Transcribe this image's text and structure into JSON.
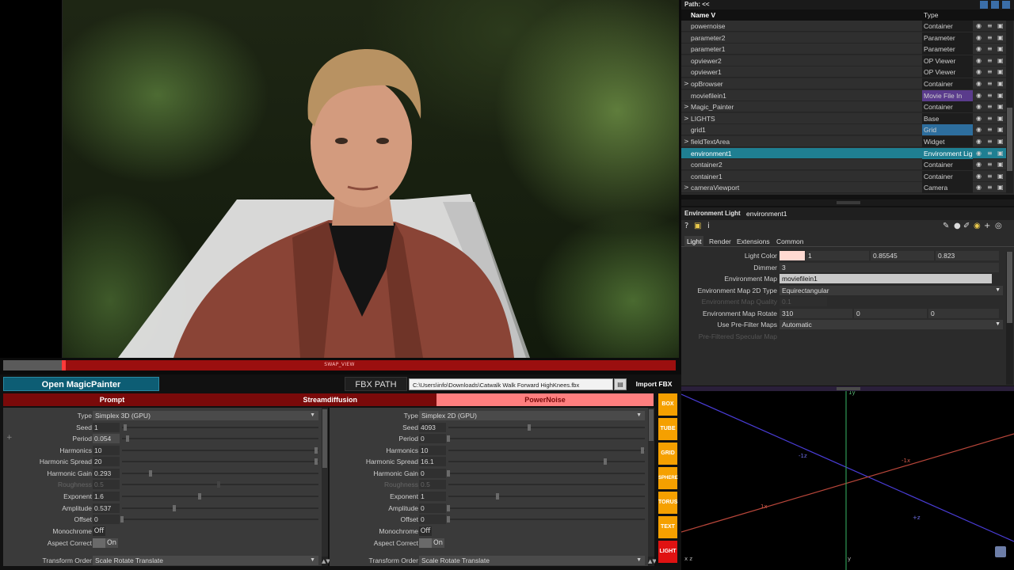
{
  "viewer": {
    "progress_label": "SWAP_VIEW",
    "progress_value": 0.09
  },
  "toolbar": {
    "open_magicpainter": "Open MagicPainter",
    "fbx_label": "FBX PATH",
    "fbx_path": "C:\\Users\\info\\Downloads\\Catwalk Walk Forward HighKnees.fbx",
    "import_fbx": "Import FBX"
  },
  "tabs": {
    "prompt": "Prompt",
    "streamdiffusion": "Streamdiffusion",
    "powernoise": "PowerNoise"
  },
  "noise_left": {
    "type": "Simplex 3D (GPU)",
    "seed": "1",
    "period": "0.054",
    "harmonics": "10",
    "harmonic_spread": "20",
    "harmonic_gain": "0.293",
    "roughness": "0.5",
    "exponent": "1.6",
    "amplitude": "0.537",
    "offset": "0",
    "monochrome": "Off",
    "aspect_correct": "On",
    "transform_order": "Scale Rotate Translate"
  },
  "noise_right": {
    "type": "Simplex 2D (GPU)",
    "seed": "4093",
    "period": "0",
    "harmonics": "10",
    "harmonic_spread": "16.1",
    "harmonic_gain": "0",
    "roughness": "0.5",
    "exponent": "1",
    "amplitude": "0",
    "offset": "0",
    "monochrome": "Off",
    "aspect_correct": "On",
    "transform_order": "Scale Rotate Translate"
  },
  "param_labels": {
    "type": "Type",
    "seed": "Seed",
    "period": "Period",
    "harmonics": "Harmonics",
    "harmonic_spread": "Harmonic Spread",
    "harmonic_gain": "Harmonic Gain",
    "roughness": "Roughness",
    "exponent": "Exponent",
    "amplitude": "Amplitude",
    "offset": "Offset",
    "monochrome": "Monochrome",
    "aspect_correct": "Aspect Correct",
    "transform_order": "Transform Order"
  },
  "shape_buttons": [
    "BOX",
    "TUBE",
    "GRID",
    "SPHERE",
    "TORUS",
    "TEXT",
    "LIGHT"
  ],
  "network": {
    "path_label": "Path: <<",
    "col_name": "Name V",
    "col_type": "Type",
    "rows": [
      {
        "name": "powernoise",
        "type": "Container",
        "expand": ""
      },
      {
        "name": "parameter2",
        "type": "Parameter",
        "expand": ""
      },
      {
        "name": "parameter1",
        "type": "Parameter",
        "expand": ""
      },
      {
        "name": "opviewer2",
        "type": "OP Viewer",
        "expand": ""
      },
      {
        "name": "opviewer1",
        "type": "OP Viewer",
        "expand": ""
      },
      {
        "name": "opBrowser",
        "type": "Container",
        "expand": ">"
      },
      {
        "name": "moviefilein1",
        "type": "Movie File In",
        "expand": ""
      },
      {
        "name": "Magic_Painter",
        "type": "Container",
        "expand": ">"
      },
      {
        "name": "LIGHTS",
        "type": "Base",
        "expand": ">"
      },
      {
        "name": "grid1",
        "type": "Grid",
        "expand": ""
      },
      {
        "name": "fieldTextArea",
        "type": "Widget",
        "expand": ">"
      },
      {
        "name": "environment1",
        "type": "Environment Light",
        "expand": ""
      },
      {
        "name": "container2",
        "type": "Container",
        "expand": ""
      },
      {
        "name": "container1",
        "type": "Container",
        "expand": ""
      },
      {
        "name": "cameraViewport",
        "type": "Camera",
        "expand": ">"
      }
    ],
    "type_colors": {
      "Movie File In": "#5a3b8c",
      "Grid": "#2d6e9e"
    }
  },
  "properties": {
    "op_type": "Environment Light",
    "op_name": "environment1",
    "tabs": [
      "Light",
      "Render",
      "Extensions",
      "Common"
    ],
    "light_color_label": "Light Color",
    "light_color": [
      "1",
      "0.85545",
      "0.823"
    ],
    "light_color_swatch": "#ffdad2",
    "dimmer_label": "Dimmer",
    "dimmer": "3",
    "env_map_label": "Environment Map",
    "env_map": "moviefilein1",
    "env_map_type_label": "Environment Map 2D Type",
    "env_map_type": "Equirectangular",
    "env_map_quality_label": "Environment Map Quality",
    "env_map_quality": "0.1",
    "env_map_rotate_label": "Environment Map Rotate",
    "env_map_rotate": [
      "310",
      "0",
      "0"
    ],
    "prefilter_label": "Use Pre-Filter Maps",
    "prefilter": "Automatic",
    "prefiltered_spec_label": "Pre-Filtered Specular Map"
  },
  "viewport": {
    "axis_labels": {
      "pz": "+z",
      "nz": "-1z",
      "px": "1x",
      "nx": "-1x",
      "py": "1y",
      "ny": "-1y"
    },
    "bottom_left": "x z",
    "bottom_center": "y"
  },
  "colors": {
    "accent_red": "#7a0a0a",
    "accent_pink": "#ff7f7f",
    "teal": "#0d5d74",
    "orange": "#f5a000",
    "selection": "#1f7f92"
  }
}
